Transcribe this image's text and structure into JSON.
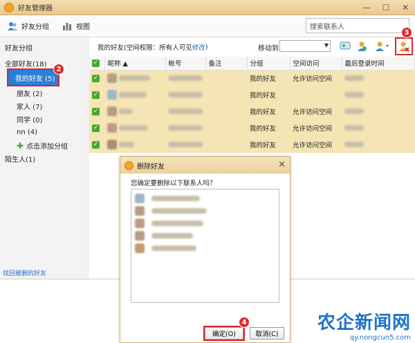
{
  "window": {
    "title": "好友管理器",
    "controls": [
      "—",
      "☐",
      "✕"
    ]
  },
  "toolbar": {
    "friend_group_label": "好友分组",
    "view_label": "视图",
    "search_value": "搜索联系人"
  },
  "sidebar": {
    "header": "好友分组",
    "all_friends": "全部好友(18)",
    "groups": [
      {
        "label": "我的好友 (5)"
      },
      {
        "label": "朋友 (2)"
      },
      {
        "label": "家人 (7)"
      },
      {
        "label": "同学 (0)"
      },
      {
        "label": "nn (4)"
      }
    ],
    "add_group": "点击添加分组",
    "strangers": "陌生人(1)",
    "recover_link": "找回被删的好友"
  },
  "content": {
    "info_prefix": "我的好友(空间权限：所有人可见",
    "info_link": "修改",
    "info_suffix": ")",
    "move_to_label": "移动到",
    "columns": [
      "昵称 ▲",
      "帐号",
      "备注",
      "分组",
      "空间访问",
      "最后登录时间"
    ],
    "rows": [
      {
        "group": "我的好友",
        "access": "允许访问空间"
      },
      {
        "group": "我的好友",
        "access": ""
      },
      {
        "group": "我的好友",
        "access": "允许访问空间"
      },
      {
        "group": "我的好友",
        "access": "允许访问空间"
      },
      {
        "group": "我的好友",
        "access": "允许访问空间"
      }
    ]
  },
  "dialog": {
    "title": "删除好友",
    "question": "您确定要删除以下联系人吗？",
    "ok_label": "确定(O)",
    "cancel_label": "取消(C)"
  },
  "badges": [
    "2",
    "3",
    "4"
  ],
  "watermark": {
    "logo": "农企新闻网",
    "url": "qy.nongcun5.com"
  },
  "colors": {
    "accent": "#2b7fd6",
    "selected_row": "#f5e4b4",
    "badge": "#e0282e",
    "check": "#49a82f"
  }
}
